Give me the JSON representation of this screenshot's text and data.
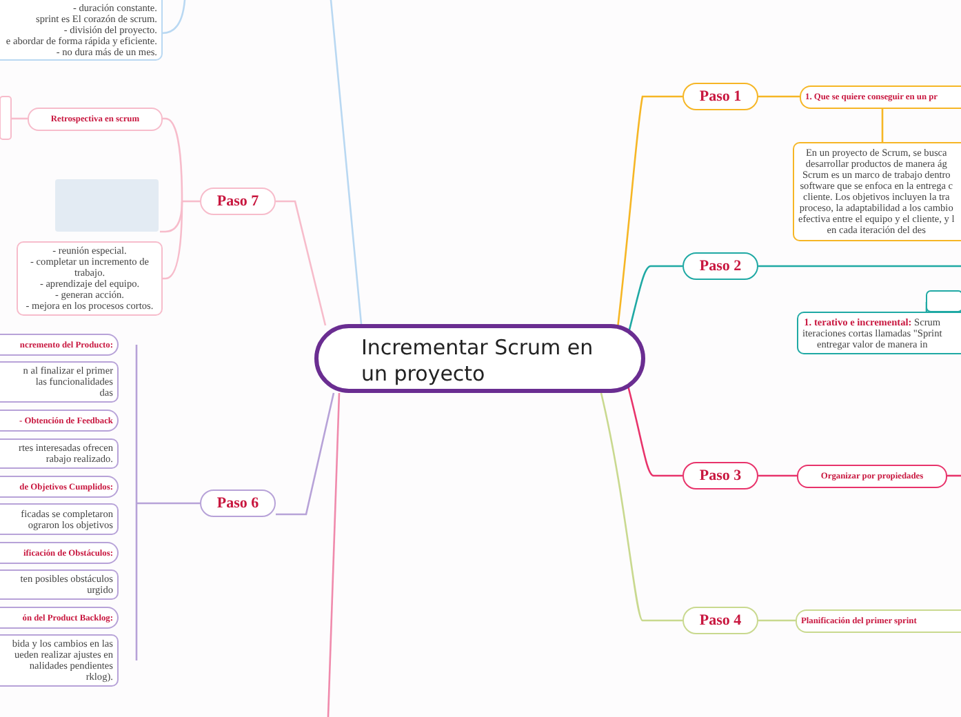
{
  "central_topic": "Incrementar Scrum en un proyecto",
  "branches": [
    {
      "color": "#b9d8f2",
      "topics": [
        {
          "kind": "note",
          "text": "- duración constante.\nsprint es El corazón de scrum.\n- división del proyecto.\ne abordar de forma rápida y eficiente.\n- no dura más de un mes."
        }
      ]
    },
    {
      "label": "Paso 7",
      "color": "#f7bccb",
      "topics": [
        {
          "kind": "heading",
          "text": "Retrospectiva en scrum"
        },
        {
          "kind": "picture"
        },
        {
          "kind": "note",
          "text": "- reunión especial.\n- completar un incremento de trabajo.\n- aprendizaje del equipo.\n- generan acción.\n- mejora en los procesos cortos."
        }
      ]
    },
    {
      "label": "Paso 1",
      "color": "#f6b625",
      "topics": [
        {
          "kind": "heading",
          "text": "1. Que se quiere conseguir en un pr"
        },
        {
          "kind": "note",
          "text": "En un proyecto de Scrum, se busca\ndesarrollar productos de manera ág\nScrum es un marco de trabajo dentro\nsoftware que se enfoca en la entrega c\ncliente. Los objetivos incluyen la tra\nproceso, la adaptabilidad a los cambio\nefectiva entre el equipo y el cliente, y l\nen cada iteración del des"
        }
      ]
    },
    {
      "label": "Paso 2",
      "color": "#1fa9a4",
      "topics": [
        {
          "kind": "note",
          "text": "**1. terativo e incremental:** Scrum\niteraciones cortas llamadas \"Sprint\nentregar valor de manera in"
        }
      ]
    },
    {
      "label": "Paso 3",
      "color": "#e8336b",
      "topics": [
        {
          "kind": "heading",
          "text": "Organizar por propiedades"
        }
      ]
    },
    {
      "label": "Paso 6",
      "color": "#b7a2d8",
      "topics": [
        {
          "kind": "heading",
          "text": "ncremento del Producto:"
        },
        {
          "kind": "note",
          "text": "n al finalizar el primer\nlas funcionalidades\ndas"
        },
        {
          "kind": "heading",
          "text": "- Obtención de Feedback"
        },
        {
          "kind": "note",
          "text": "rtes interesadas ofrecen\nrabajo realizado."
        },
        {
          "kind": "heading",
          "text": "de Objetivos Cumplidos:"
        },
        {
          "kind": "note",
          "text": "ficadas se completaron\nograron los objetivos"
        },
        {
          "kind": "heading",
          "text": "ificación de Obstáculos:"
        },
        {
          "kind": "note",
          "text": "ten posibles obstáculos\nurgido"
        },
        {
          "kind": "heading",
          "text": "ón del Product Backlog:"
        },
        {
          "kind": "note",
          "text": "bida y los cambios en las\nueden realizar ajustes en\nnalidades pendientes\nrklog)."
        }
      ]
    },
    {
      "label": "Paso 4",
      "color": "#c9d98f",
      "topics": [
        {
          "kind": "heading",
          "text": "Planificación del primer sprint"
        }
      ]
    }
  ]
}
